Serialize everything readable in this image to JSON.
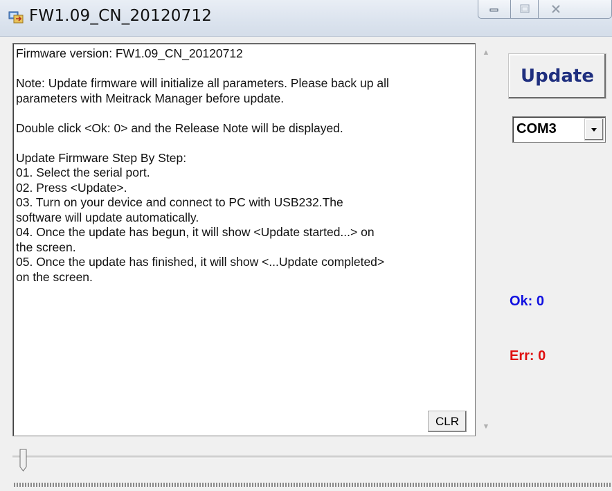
{
  "window": {
    "title": "FW1.09_CN_20120712",
    "icon": "app-transfer-icon",
    "controls": [
      "minimize-icon",
      "maximize-icon",
      "close-icon"
    ]
  },
  "log": {
    "lines": [
      "Firmware version: FW1.09_CN_20120712",
      "",
      "Note: Update firmware will initialize all parameters. Please back up all",
      "parameters with Meitrack Manager before update.",
      "",
      "Double click <Ok: 0> and the Release Note will be displayed.",
      "",
      "Update Firmware Step By Step:",
      "01. Select the serial port.",
      "02. Press <Update>.",
      "03. Turn on your device and connect to PC with USB232.The",
      "software will update automatically.",
      "04. Once the update has begun, it will show <Update started...> on",
      "the screen.",
      "05. Once the update has finished, it will show <...Update completed>",
      "on the screen."
    ],
    "clear_label": "CLR"
  },
  "controls": {
    "update_label": "Update",
    "port_selected": "COM3",
    "ok_status": "Ok: 0",
    "err_status": "Err: 0"
  },
  "colors": {
    "update_text": "#1f2f7f",
    "ok": "#1010e0",
    "err": "#e01010"
  },
  "slider": {
    "value": 0
  }
}
